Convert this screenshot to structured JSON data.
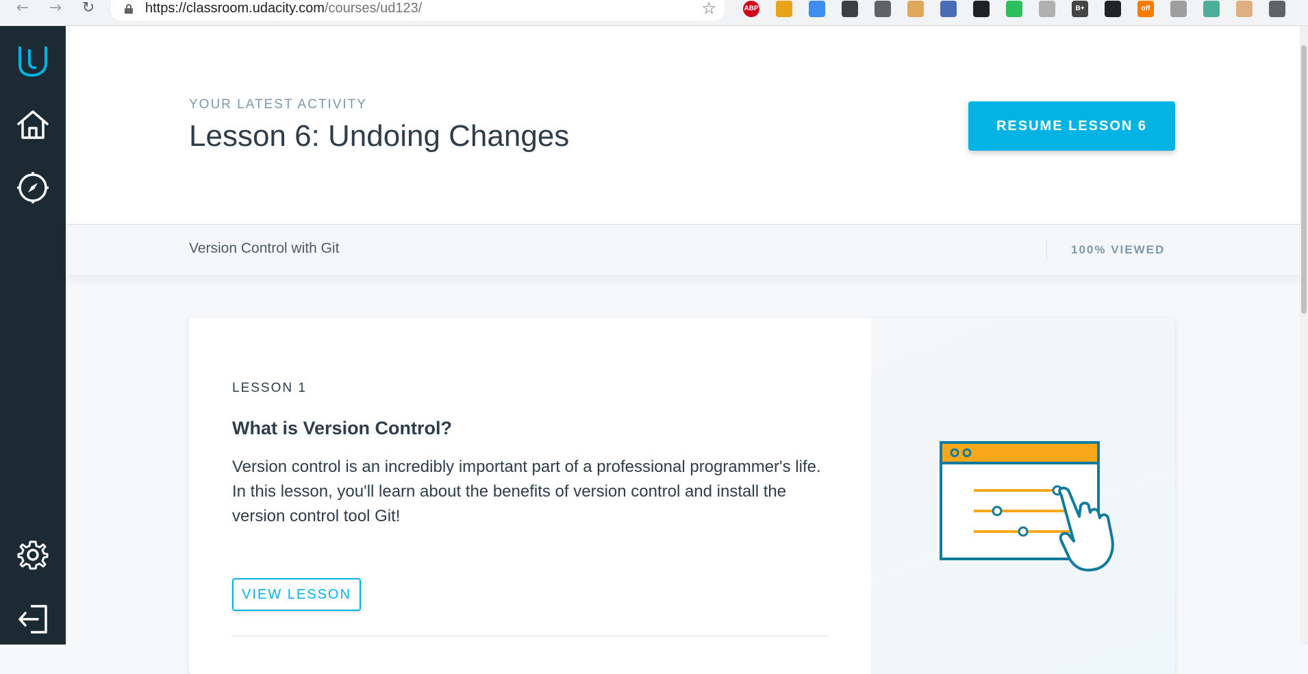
{
  "browser": {
    "url_domain": "https://classroom.udacity.com",
    "url_path": "/courses/ud123/",
    "extensions": [
      {
        "name": "adblock-plus-icon",
        "label": "ABP",
        "color": "#d0021b"
      },
      {
        "name": "pinwheel-extension-icon",
        "label": "",
        "color": "#e8a318"
      },
      {
        "name": "cloud-extension-icon",
        "label": "",
        "color": "#3d8ef0"
      },
      {
        "name": "code-extension-icon",
        "label": "",
        "color": "#3c4043"
      },
      {
        "name": "recycle-extension-icon",
        "label": "",
        "color": "#5f6368"
      },
      {
        "name": "ruler-extension-icon",
        "label": "",
        "color": "#e0a85a"
      },
      {
        "name": "eyedropper-extension-icon",
        "label": "",
        "color": "#4a6bb5"
      },
      {
        "name": "terminal-extension-icon",
        "label": "",
        "color": "#202124"
      },
      {
        "name": "evernote-icon",
        "label": "",
        "color": "#2dbe60"
      },
      {
        "name": "pdf-extension-icon",
        "label": "",
        "color": "#b0b0b0"
      },
      {
        "name": "b-plus-extension-icon",
        "label": "B+",
        "color": "#444444"
      },
      {
        "name": "react-devtools-icon",
        "label": "",
        "color": "#20232a"
      },
      {
        "name": "off-badge-extension-icon",
        "label": "off",
        "color": "#f57c00"
      },
      {
        "name": "rss-extension-icon",
        "label": "",
        "color": "#9e9e9e"
      },
      {
        "name": "target-extension-icon",
        "label": "",
        "color": "#4caf9a"
      },
      {
        "name": "profile-avatar-icon",
        "label": "",
        "color": "#e0b080"
      },
      {
        "name": "update-arrow-icon",
        "label": "",
        "color": "#5f6368"
      }
    ]
  },
  "sidebar": {
    "items": [
      {
        "name": "udacity-logo-icon"
      },
      {
        "name": "home-icon"
      },
      {
        "name": "compass-icon"
      },
      {
        "name": "settings-gear-icon"
      },
      {
        "name": "logout-icon"
      }
    ]
  },
  "hero": {
    "eyebrow": "YOUR LATEST ACTIVITY",
    "title": "Lesson 6: Undoing Changes",
    "resume_label": "RESUME LESSON 6"
  },
  "course_bar": {
    "course_name": "Version Control with Git",
    "progress_label": "100% VIEWED"
  },
  "lesson_card": {
    "label": "LESSON 1",
    "title": "What is Version Control?",
    "description": "Version control is an incredibly important part of a professional programmer's life. In this lesson, you'll learn about the benefits of version control and install the version control tool Git!",
    "button_label": "VIEW LESSON"
  },
  "colors": {
    "accent": "#02b3e4",
    "sidebar": "#1b2a33",
    "illustration_teal": "#117b9e",
    "illustration_orange": "#f9a81a"
  }
}
